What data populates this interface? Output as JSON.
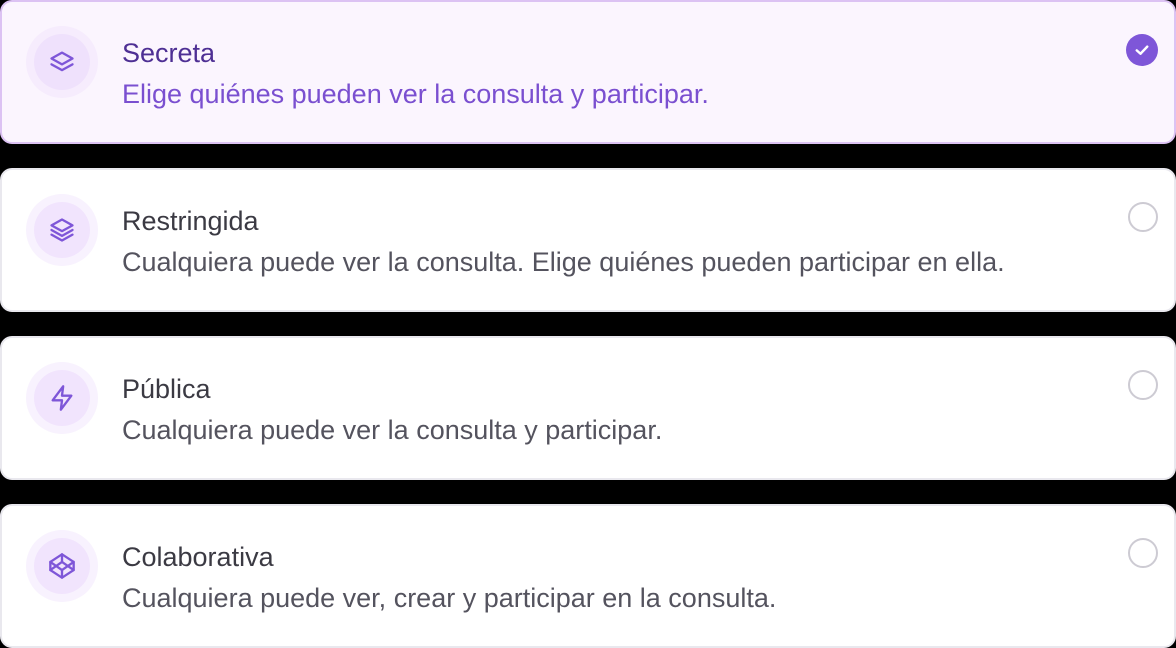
{
  "options": [
    {
      "title": "Secreta",
      "description": "Elige quiénes pueden ver la consulta y participar.",
      "icon": "layers-icon",
      "selected": true
    },
    {
      "title": "Restringida",
      "description": "Cualquiera puede ver la consulta. Elige quiénes pueden participar en ella.",
      "icon": "layers-three-icon",
      "selected": false
    },
    {
      "title": "Pública",
      "description": "Cualquiera puede ver la consulta y participar.",
      "icon": "zap-icon",
      "selected": false
    },
    {
      "title": "Colaborativa",
      "description": "Cualquiera puede ver, crear y participar en la consulta.",
      "icon": "codepen-icon",
      "selected": false
    }
  ],
  "colors": {
    "accent": "#7e56d8",
    "selected_bg": "#fbf5fe",
    "selected_border": "#dcc2f3",
    "selected_title": "#4e2f94",
    "selected_desc": "#7a4fd0",
    "title": "#3b3a43",
    "description": "#54535e"
  }
}
